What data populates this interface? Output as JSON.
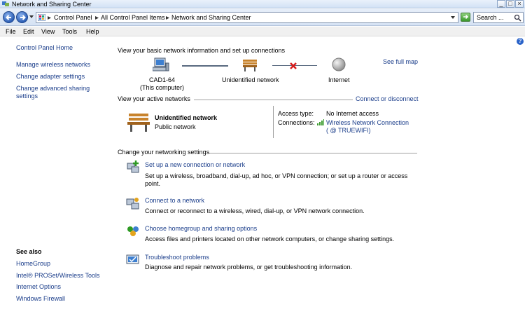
{
  "window": {
    "title": "Network and Sharing Center"
  },
  "address": {
    "crumbs": [
      "Control Panel",
      "All Control Panel Items",
      "Network and Sharing Center"
    ],
    "search_placeholder": "Search ..."
  },
  "menu": [
    "File",
    "Edit",
    "View",
    "Tools",
    "Help"
  ],
  "left": {
    "home": "Control Panel Home",
    "links": [
      "Manage wireless networks",
      "Change adapter settings",
      "Change advanced sharing",
      "settings"
    ],
    "see_also_title": "See also",
    "see_also": [
      "HomeGroup",
      "Intel® PROSet/Wireless Tools",
      "Internet Options",
      "Windows Firewall"
    ]
  },
  "main": {
    "heading": "View your basic network information and set up connections",
    "see_full_map": "See full map",
    "map": {
      "computer_name": "CAD1-64",
      "computer_sub": "(This computer)",
      "network": "Unidentified network",
      "internet": "Internet"
    },
    "active_heading": "View your active networks",
    "connect_disconnect": "Connect or disconnect",
    "active": {
      "name": "Unidentified network",
      "type": "Public network",
      "access_label": "Access type:",
      "access_value": "No Internet access",
      "conn_label": "Connections:",
      "conn_value": "Wireless Network Connection",
      "conn_ssid": "( @  TRUEWIFI)"
    },
    "change_heading": "Change your networking settings",
    "tasks": [
      {
        "title": "Set up a new connection or network",
        "desc1": "Set up a wireless, broadband, dial-up, ad hoc, or VPN connection; or set up a router or access",
        "desc2": "point."
      },
      {
        "title": "Connect to a network",
        "desc1": "Connect or reconnect to a wireless, wired, dial-up, or VPN network connection."
      },
      {
        "title": "Choose homegroup and sharing options",
        "desc1": "Access files and printers located on other network computers, or change sharing settings."
      },
      {
        "title": "Troubleshoot problems",
        "desc1": "Diagnose and repair network problems, or get troubleshooting information."
      }
    ]
  }
}
